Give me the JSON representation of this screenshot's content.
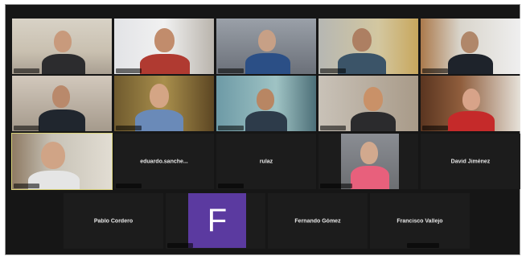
{
  "participants": [
    {
      "id": "p1",
      "type": "video"
    },
    {
      "id": "p2",
      "type": "video"
    },
    {
      "id": "p3",
      "type": "video"
    },
    {
      "id": "p4",
      "type": "video"
    },
    {
      "id": "p5",
      "type": "video"
    },
    {
      "id": "p6",
      "type": "video"
    },
    {
      "id": "p7",
      "type": "video"
    },
    {
      "id": "p8",
      "type": "video"
    },
    {
      "id": "p9",
      "type": "video"
    },
    {
      "id": "p10",
      "type": "video"
    },
    {
      "id": "p11",
      "type": "video",
      "active": true
    },
    {
      "id": "p12",
      "type": "name",
      "name": "eduardo.sanche..."
    },
    {
      "id": "p13",
      "type": "name",
      "name": "rulaz"
    },
    {
      "id": "p14",
      "type": "video"
    },
    {
      "id": "p15",
      "type": "name",
      "name": "David Jiménez"
    },
    {
      "id": "p16",
      "type": "name",
      "name": "Pablo Cordero"
    },
    {
      "id": "p17",
      "type": "avatar",
      "initial": "F"
    },
    {
      "id": "p18",
      "type": "name",
      "name": "Fernando Gómez"
    },
    {
      "id": "p19",
      "type": "name",
      "name": "Francisco Vallejo"
    }
  ],
  "colors": {
    "frame_bg": "#161616",
    "tile_bg": "#1c1c1c",
    "active_outline": "#d9d27a",
    "avatar_bg": "#5b3aa0"
  }
}
